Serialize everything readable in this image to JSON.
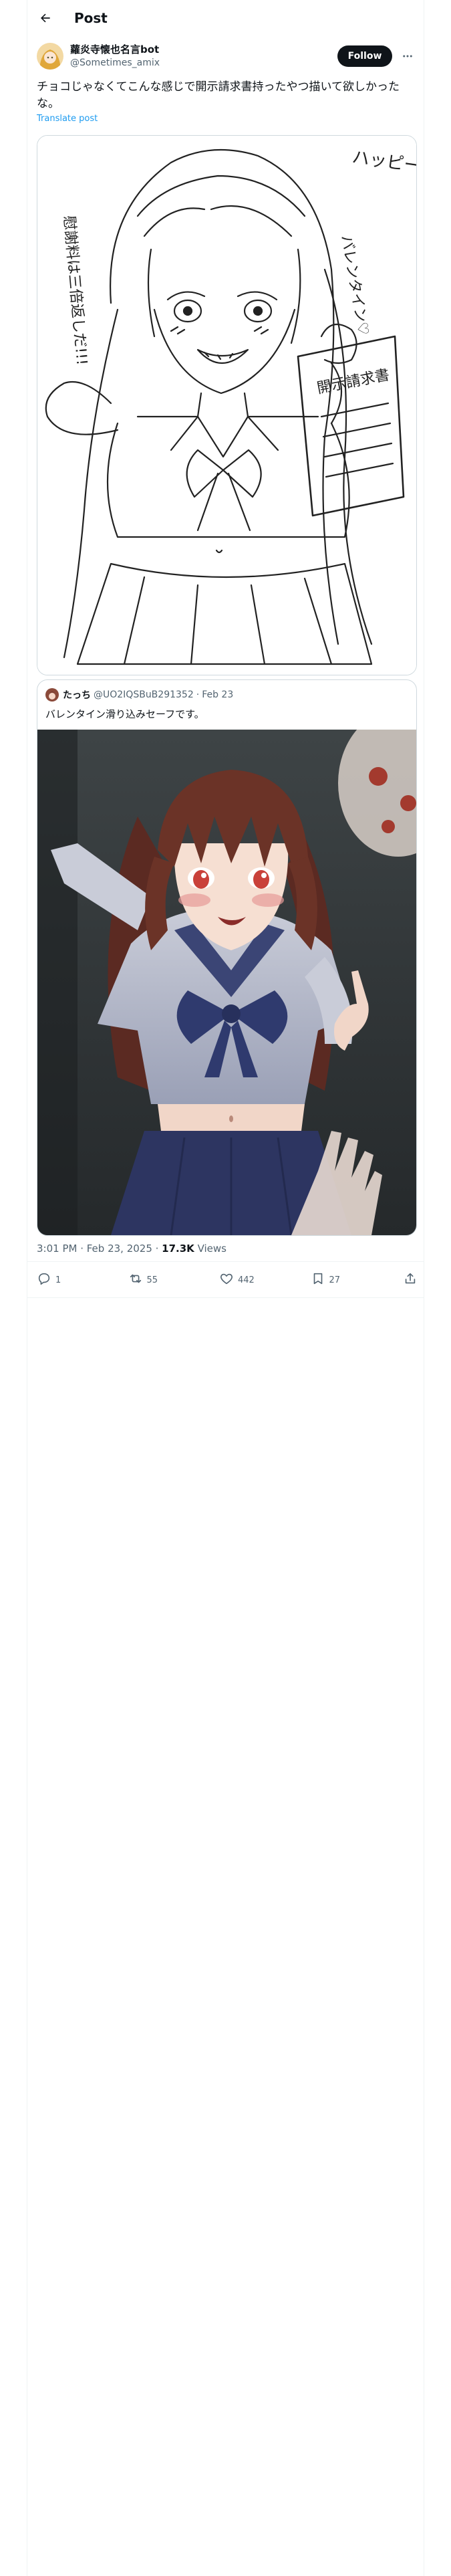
{
  "header": {
    "title": "Post"
  },
  "post": {
    "display_name": "蘿炎寺懐也名言bot",
    "handle": "@Sometimes_amix",
    "text": "チョコじゃなくてこんな感じで開示請求書持ったやつ描いて欲しかったな。",
    "translate": "Translate post",
    "follow_label": "Follow",
    "drawing_text": {
      "happy": "ハッピー",
      "valentine": "バレンタイン♡",
      "side_note": "慰謝料は三倍返しだ!!!",
      "document": "開示請求書"
    },
    "timestamp": "3:01 PM · Feb 23, 2025 · ",
    "views_count": "17.3K",
    "views_label": " Views"
  },
  "quote": {
    "display_name": "たっち",
    "handle": "@UO2IQSBuB291352",
    "dot": "·",
    "date": "Feb 23",
    "text": "バレンタイン滑り込みセーフです。"
  },
  "actions": {
    "replies": "1",
    "reposts": "55",
    "likes": "442",
    "bookmarks": "27"
  },
  "colors": {
    "accent": "#1d9bf0",
    "text": "#0f1419",
    "muted": "#536471",
    "border": "#cfd9de"
  }
}
